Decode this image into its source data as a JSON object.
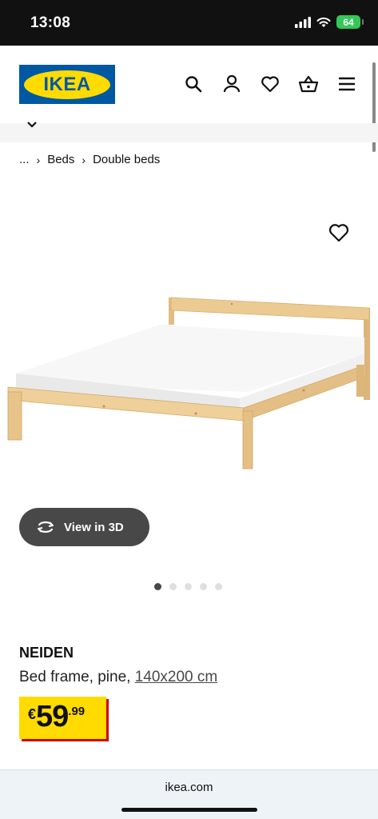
{
  "status_bar": {
    "time": "13:08",
    "battery": "64"
  },
  "header": {
    "logo_text": "IKEA"
  },
  "breadcrumb": {
    "ellipsis": "...",
    "items": [
      "Beds",
      "Double beds"
    ]
  },
  "view3d": {
    "label": "View in 3D"
  },
  "carousel": {
    "count": 5,
    "active_index": 0
  },
  "product": {
    "name": "NEIDEN",
    "description": "Bed frame, pine,",
    "size": "140x200 cm",
    "price": {
      "currency": "€",
      "integer": "59",
      "decimal": ".99"
    }
  },
  "browser": {
    "url": "ikea.com"
  },
  "colors": {
    "ikea_blue": "#0058a3",
    "ikea_yellow": "#ffdb00",
    "price_red": "#cc0008",
    "pine": "#e8c48a"
  }
}
